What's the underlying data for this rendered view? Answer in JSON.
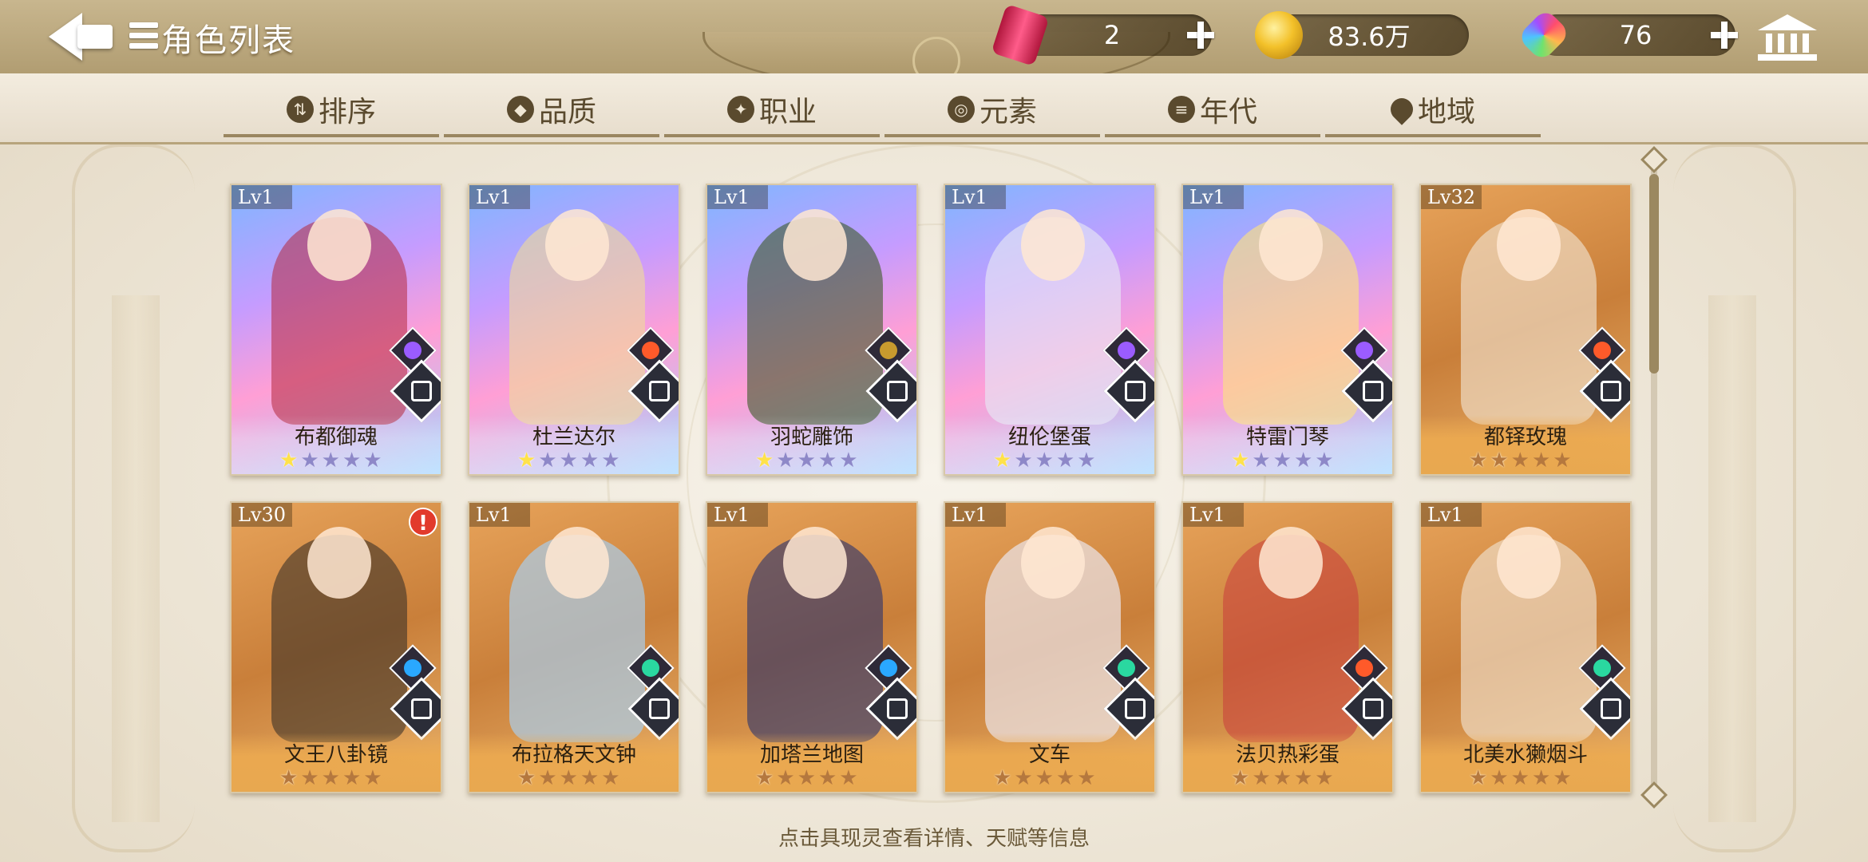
{
  "header": {
    "title": "角色列表",
    "currencies": [
      {
        "icon": "soda-can-icon",
        "value": "2"
      },
      {
        "icon": "gold-coin-icon",
        "value": "83.6万"
      },
      {
        "icon": "rainbow-gem-icon",
        "value": "76"
      }
    ]
  },
  "filters": [
    {
      "icon": "sort-icon",
      "label": "排序"
    },
    {
      "icon": "quality-icon",
      "label": "品质"
    },
    {
      "icon": "class-icon",
      "label": "职业"
    },
    {
      "icon": "element-icon",
      "label": "元素"
    },
    {
      "icon": "era-icon",
      "label": "年代"
    },
    {
      "icon": "location-pin-icon",
      "label": "地域"
    }
  ],
  "cards": [
    {
      "level": "Lv1",
      "name": "布都御魂",
      "stars": 1,
      "rarity": "r5",
      "element": "thunder",
      "element_color": "#9b5cff",
      "class": "crossed-swords"
    },
    {
      "level": "Lv1",
      "name": "杜兰达尔",
      "stars": 1,
      "rarity": "r5",
      "element": "fire",
      "element_color": "#ff5a2a",
      "class": "shield"
    },
    {
      "level": "Lv1",
      "name": "羽蛇雕饰",
      "stars": 1,
      "rarity": "r5",
      "element": "earth",
      "element_color": "#c89a2e",
      "class": "wings"
    },
    {
      "level": "Lv1",
      "name": "纽伦堡蛋",
      "stars": 1,
      "rarity": "r5",
      "element": "thunder",
      "element_color": "#9b5cff",
      "class": "book"
    },
    {
      "level": "Lv1",
      "name": "特雷门琴",
      "stars": 1,
      "rarity": "r5",
      "element": "thunder",
      "element_color": "#9b5cff",
      "class": "cross"
    },
    {
      "level": "Lv32",
      "name": "都铎玫瑰",
      "stars": 2,
      "rarity": "r4",
      "element": "fire",
      "element_color": "#ff5a2a",
      "class": "wings"
    },
    {
      "level": "Lv30",
      "name": "文王八卦镜",
      "stars": 1,
      "rarity": "r4",
      "element": "water",
      "element_color": "#2aa8ff",
      "class": "shield",
      "alert": "!"
    },
    {
      "level": "Lv1",
      "name": "布拉格天文钟",
      "stars": 1,
      "rarity": "r4",
      "element": "wind",
      "element_color": "#2ad8a0",
      "class": "wings"
    },
    {
      "level": "Lv1",
      "name": "加塔兰地图",
      "stars": 1,
      "rarity": "r4",
      "element": "water",
      "element_color": "#2aa8ff",
      "class": "shield"
    },
    {
      "level": "Lv1",
      "name": "文车",
      "stars": 1,
      "rarity": "r4",
      "element": "wind",
      "element_color": "#2ad8a0",
      "class": "book"
    },
    {
      "level": "Lv1",
      "name": "法贝热彩蛋",
      "stars": 1,
      "rarity": "r4",
      "element": "fire",
      "element_color": "#ff5a2a",
      "class": "book"
    },
    {
      "level": "Lv1",
      "name": "北美水獭烟斗",
      "stars": 1,
      "rarity": "r4",
      "element": "wind",
      "element_color": "#2ad8a0",
      "class": "book"
    }
  ],
  "hint": "点击具现灵查看详情、天赋等信息",
  "colors": {
    "accent": "#b19d72",
    "text_dark": "#5a4a2e"
  }
}
